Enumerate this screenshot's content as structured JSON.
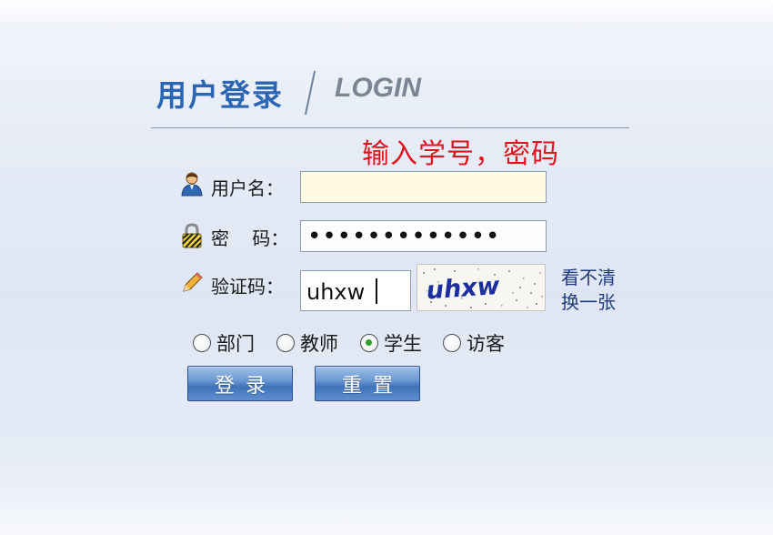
{
  "header": {
    "title_cn": "用户登录",
    "title_en": "LOGIN"
  },
  "hint": "输入学号，密码",
  "form": {
    "username": {
      "label": "用户名：",
      "value": ""
    },
    "password": {
      "label": "密    码：",
      "value": "•••••••••••••"
    },
    "captcha": {
      "label": "验证码：",
      "value": "uhxw",
      "image_text": "uhxw",
      "refresh_line1": "看不清",
      "refresh_line2": "换一张"
    }
  },
  "roles": [
    {
      "label": "部门",
      "checked": false
    },
    {
      "label": "教师",
      "checked": false
    },
    {
      "label": "学生",
      "checked": true
    },
    {
      "label": "访客",
      "checked": false
    }
  ],
  "buttons": {
    "login": "登录",
    "reset": "重置"
  },
  "colors": {
    "title": "#2a66b3",
    "hint": "#e0141c",
    "username_bg": "#fffbe0",
    "button": "#3f72b9"
  },
  "icons": {
    "username": "user-icon",
    "password": "lock-icon",
    "captcha": "pencil-icon"
  }
}
